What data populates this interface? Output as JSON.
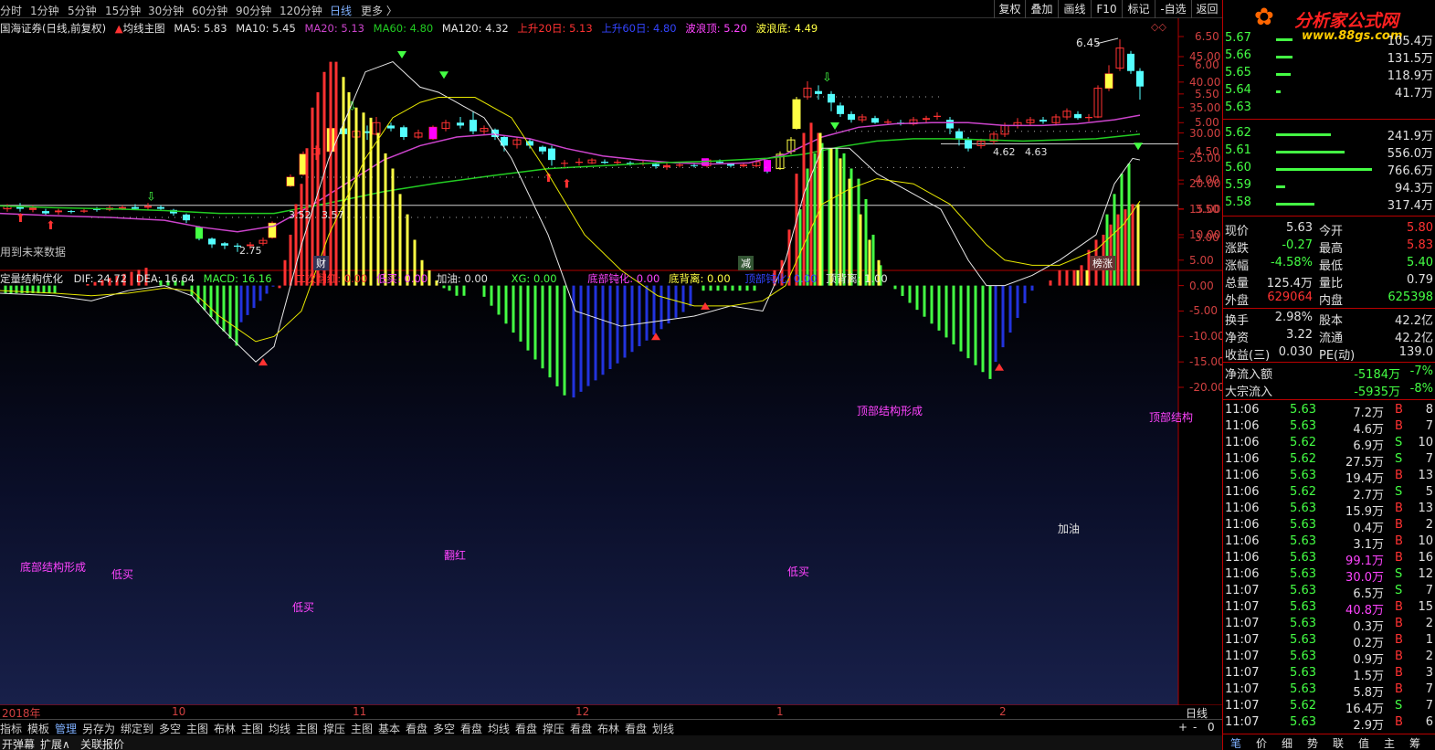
{
  "colors": {
    "up": "#ff3232",
    "down": "#54ffff",
    "ma20": "#cc44cc",
    "ma60": "#22cc22",
    "yellow": "#ffff44",
    "green": "#44ff44",
    "blue": "#2233dd",
    "magenta": "#ff00ff",
    "axis_red": "#b00000"
  },
  "toolbar": {
    "periods": [
      "分时",
      "1分钟",
      "5分钟",
      "15分钟",
      "30分钟",
      "60分钟",
      "90分钟",
      "120分钟",
      "日线",
      "更多 〉"
    ],
    "buttons": [
      "复权",
      "叠加",
      "画线",
      "F10",
      "标记",
      "-自选",
      "返回"
    ]
  },
  "main_legend": {
    "stock": "国海证券(日线,前复权)",
    "ma_main": "均线主图",
    "ma5": "MA5: 5.83",
    "ma10": "MA10: 5.45",
    "ma20": "MA20: 5.13",
    "ma60": "MA60: 4.80",
    "ma120": "MA120: 4.32",
    "up20": "上升20日: 5.13",
    "up60": "上升60日: 4.80",
    "wave_top": "波浪顶: 5.20",
    "wave_bottom": "波浪底: 4.49"
  },
  "main_annotations": {
    "high": "6.45",
    "low": "2.75",
    "l1": "3.52",
    "l2": "3.57",
    "m1": "4.62",
    "m2": "4.63",
    "future_note": "用到未来数据",
    "mark_cai": "财",
    "mark_jian": "减",
    "mark_bang": "榜涨"
  },
  "main_axis": [
    "6.50",
    "6.00",
    "5.50",
    "5.00",
    "4.50",
    "4.00",
    "3.50",
    "3.00"
  ],
  "ind_legend": {
    "name": "定量结构优化",
    "dif": "DIF: 24.72",
    "dea": "DEA: 16.64",
    "macd": "MACD: 16.16",
    "erci": "二次翻红: 0.00",
    "dimai": "低买: 0.00",
    "jiayou": "加油: 0.00",
    "xg": "XG: 0.00",
    "dbdh": "底部钝化: 0.00",
    "dbl": "底背离: 0.00",
    "dbdh2": "顶部钝化: 0.00",
    "dbl2": "顶背离: 1.00"
  },
  "ind_annotations": {
    "top1": "顶部结构形成",
    "top2": "顶部结构",
    "bottom": "底部结构形成",
    "dimai": "低买",
    "jiayou": "加油",
    "fanhong": "翻红"
  },
  "ind_axis": [
    "45.00",
    "40.00",
    "35.00",
    "30.00",
    "25.00",
    "20.00",
    "15.00",
    "10.00",
    "5.00",
    "0.00",
    "-5.00",
    "-10.00",
    "-15.00",
    "-20.00"
  ],
  "date_axis": [
    "2018年",
    "10",
    "11",
    "12",
    "1",
    "2"
  ],
  "bottom_tabs": [
    "指标",
    "模板",
    "管理",
    "另存为",
    "绑定到",
    "多空",
    "主图",
    "布林",
    "主图",
    "均线",
    "主图",
    "撑压",
    "主图",
    "基本",
    "看盘",
    "多空",
    "看盘",
    "均线",
    "看盘",
    "撑压",
    "看盘",
    "布林",
    "看盘",
    "划线"
  ],
  "footer": [
    "开弹幕",
    "扩展∧",
    "关联报价"
  ],
  "right": {
    "logo": "分析家公式网",
    "logo_url": "www.88gs.com",
    "asks": [
      [
        "5.67",
        "105.4万"
      ],
      [
        "5.66",
        "131.5万"
      ],
      [
        "5.65",
        "118.9万"
      ],
      [
        "5.64",
        "41.7万"
      ],
      [
        "5.63",
        ""
      ]
    ],
    "bids": [
      [
        "5.62",
        "241.9万"
      ],
      [
        "5.61",
        "556.0万"
      ],
      [
        "5.60",
        "766.6万"
      ],
      [
        "5.59",
        "94.3万"
      ],
      [
        "5.58",
        "317.4万"
      ]
    ],
    "stats": [
      [
        "现价",
        "5.63",
        "今开",
        "5.80"
      ],
      [
        "涨跌",
        "-0.27",
        "最高",
        "5.83"
      ],
      [
        "涨幅",
        "-4.58%",
        "最低",
        "5.40"
      ],
      [
        "总量",
        "125.4万",
        "量比",
        "0.79"
      ],
      [
        "外盘",
        "629064",
        "内盘",
        "625398"
      ]
    ],
    "stats2": [
      [
        "换手",
        "2.98%",
        "股本",
        "42.2亿"
      ],
      [
        "净资",
        "3.22",
        "流通",
        "42.2亿"
      ],
      [
        "收益(三)",
        "0.030",
        "PE(动)",
        "139.0"
      ]
    ],
    "flow": [
      [
        "净流入额",
        "-5184万",
        "-7%"
      ],
      [
        "大宗流入",
        "-5935万",
        "-8%"
      ]
    ],
    "ticks": [
      [
        "11:06",
        "5.63",
        "7.2万",
        "B",
        "8"
      ],
      [
        "11:06",
        "5.63",
        "4.6万",
        "B",
        "7"
      ],
      [
        "11:06",
        "5.62",
        "6.9万",
        "S",
        "10"
      ],
      [
        "11:06",
        "5.62",
        "27.5万",
        "S",
        "7"
      ],
      [
        "11:06",
        "5.63",
        "19.4万",
        "B",
        "13"
      ],
      [
        "11:06",
        "5.62",
        "2.7万",
        "S",
        "5"
      ],
      [
        "11:06",
        "5.63",
        "15.9万",
        "B",
        "13"
      ],
      [
        "11:06",
        "5.63",
        "0.4万",
        "B",
        "2"
      ],
      [
        "11:06",
        "5.63",
        "3.1万",
        "B",
        "10"
      ],
      [
        "11:06",
        "5.63",
        "99.1万",
        "B",
        "16"
      ],
      [
        "11:06",
        "5.63",
        "30.0万",
        "S",
        "12"
      ],
      [
        "11:07",
        "5.63",
        "6.5万",
        "S",
        "7"
      ],
      [
        "11:07",
        "5.63",
        "40.8万",
        "B",
        "15"
      ],
      [
        "11:07",
        "5.63",
        "0.3万",
        "B",
        "2"
      ],
      [
        "11:07",
        "5.63",
        "0.2万",
        "B",
        "1"
      ],
      [
        "11:07",
        "5.63",
        "0.9万",
        "B",
        "2"
      ],
      [
        "11:07",
        "5.63",
        "1.5万",
        "B",
        "3"
      ],
      [
        "11:07",
        "5.63",
        "5.8万",
        "B",
        "7"
      ],
      [
        "11:07",
        "5.62",
        "16.4万",
        "S",
        "7"
      ],
      [
        "11:07",
        "5.63",
        "2.9万",
        "B",
        "6"
      ]
    ],
    "bottom_tabs": [
      "笔",
      "价",
      "细",
      "势",
      "联",
      "值",
      "主",
      "筹"
    ],
    "period_label": "日线"
  }
}
